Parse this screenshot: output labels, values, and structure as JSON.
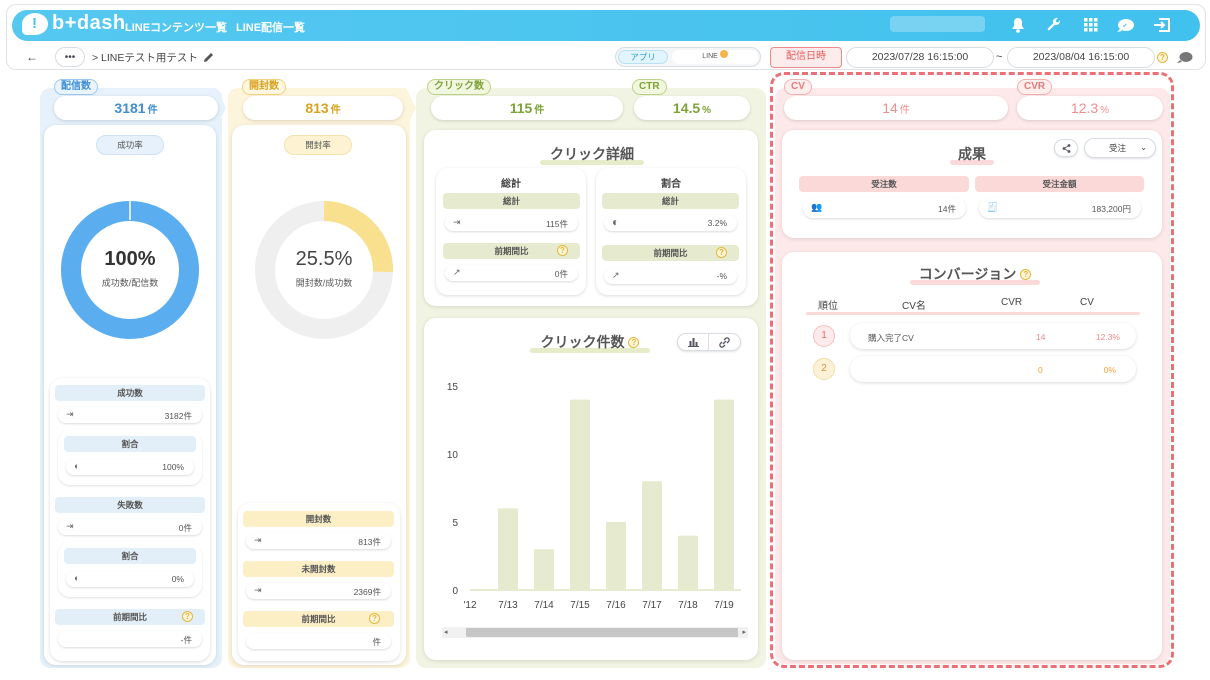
{
  "header": {
    "logo": "b+dash",
    "nav": [
      "LINEコンテンツ一覧",
      "LINE配信一覧"
    ],
    "icons": [
      "bell-icon",
      "wrench-icon",
      "grid-icon",
      "chat-icon",
      "logout-icon"
    ]
  },
  "subbar": {
    "back": "←",
    "more": "•••",
    "breadcrumb": "> LINEテスト用テスト",
    "seg_app": "アプリ",
    "seg_line": "LINE",
    "date_button": "配信日時",
    "date_from": "2023/07/28 16:15:00",
    "tilde": "~",
    "date_to": "2023/08/04 16:15:00"
  },
  "delivery": {
    "tag": "配信数",
    "value": "3181",
    "unit": "件",
    "rate_label": "成功率",
    "donut_percent": "100%",
    "donut_caption": "成功数/配信数",
    "donut_fraction": 1.0,
    "success_label": "成功数",
    "success_value": "3182件",
    "ratio_label": "割合",
    "ratio_value": "100%",
    "fail_label": "失敗数",
    "fail_value": "0件",
    "fail_ratio_label": "割合",
    "fail_ratio_value": "0%",
    "prev_label": "前期間比",
    "prev_value": "-件"
  },
  "open": {
    "tag": "開封数",
    "value": "813",
    "unit": "件",
    "rate_label": "開封率",
    "donut_percent": "25.5%",
    "donut_caption": "開封数/成功数",
    "donut_fraction": 0.255,
    "opened_label": "開封数",
    "opened_value": "813",
    "opened_unit": "件",
    "unopened_label": "未開封数",
    "unopened_value": "2369",
    "unopened_unit": "件",
    "prev_label": "前期間比",
    "prev_value": "件"
  },
  "click": {
    "tag": "クリック数",
    "value": "115",
    "unit": "件",
    "ctr_tag": "CTR",
    "ctr_value": "14.5",
    "ctr_unit": "%",
    "detail_title": "クリック詳細",
    "total_head": "総計",
    "total_sub": "総計",
    "total_value": "115件",
    "total_prev": "前期間比",
    "total_prev_value": "0件",
    "ratio_head": "割合",
    "ratio_sub": "総計",
    "ratio_value": "3.2%",
    "ratio_prev": "前期間比",
    "ratio_prev_value": "-%",
    "count_title": "クリック件数"
  },
  "chart_data": {
    "type": "bar",
    "categories": [
      "7/12",
      "7/13",
      "7/14",
      "7/15",
      "7/16",
      "7/17",
      "7/18",
      "7/19"
    ],
    "values": [
      0,
      6,
      3,
      14,
      5,
      8,
      4,
      14
    ],
    "ylim": [
      0,
      15
    ],
    "yticks": [
      "0",
      "5",
      "10",
      "15"
    ],
    "tick_labels": [
      "'12",
      "7/13",
      "7/14",
      "7/15",
      "7/16",
      "7/17",
      "7/18",
      "7/19"
    ],
    "color": "#e6ebcf"
  },
  "cv": {
    "tag": "CV",
    "value": "14",
    "unit": "件",
    "cvr_tag": "CVR",
    "cvr_value": "12.3",
    "cvr_unit": "%",
    "result_title": "成果",
    "dropdown": "受注",
    "orders_label": "受注数",
    "orders_value": "14件",
    "amount_label": "受注金額",
    "amount_value": "183,200円",
    "conv_title": "コンバージョン",
    "headers": [
      "順位",
      "CV名",
      "CVR",
      "CV"
    ],
    "rows": [
      {
        "rank": "1",
        "name": "購入完了CV",
        "cvr": "14",
        "cv": "12.3%"
      },
      {
        "rank": "2",
        "name": "",
        "cvr": "0",
        "cv": "0%"
      }
    ]
  },
  "colors": {
    "blue": "#5aaef0",
    "yellow": "#f8e08e",
    "green": "#c5d49a",
    "pink": "#f08a8a",
    "header": "#41c1ee"
  }
}
